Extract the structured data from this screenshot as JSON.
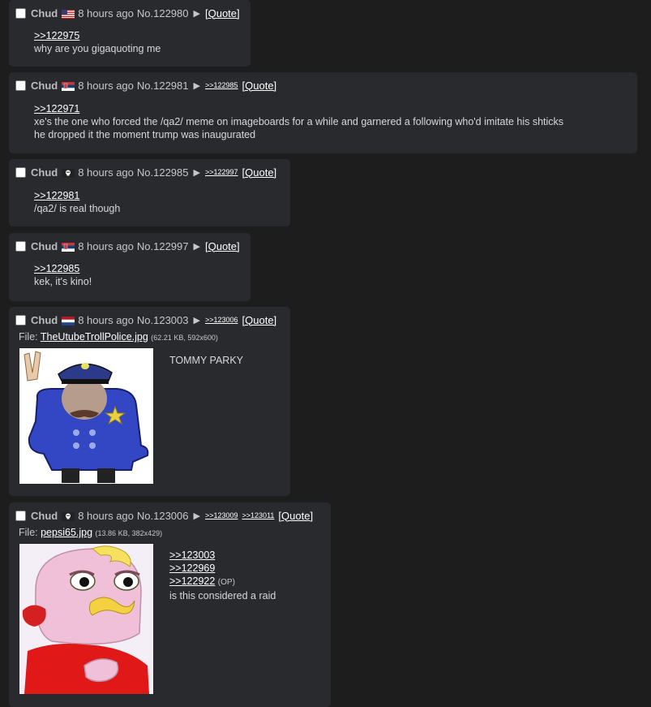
{
  "posts": {
    "p1": {
      "name": "Chud",
      "time": "8 hours ago",
      "no": "No.122980",
      "quote": "[Quote]",
      "lines": {
        "q1": ">>122975",
        "t1": "why are you gigaquoting me"
      }
    },
    "p2": {
      "name": "Chud",
      "time": "8 hours ago",
      "no": "No.122981",
      "backlinks": {
        "b1": ">>122985"
      },
      "quote": "[Quote]",
      "lines": {
        "q1": ">>122971",
        "t1": "xe's the one who forced the /qa2/ meme on imageboards for a while and garnered a following who'd imitate his shticks",
        "t2": "he dropped it the moment trump was inaugurated"
      }
    },
    "p3": {
      "name": "Chud",
      "time": "8 hours ago",
      "no": "No.122985",
      "backlinks": {
        "b1": ">>122997"
      },
      "quote": "[Quote]",
      "lines": {
        "q1": ">>122981",
        "t1": "/qa2/ is real though"
      }
    },
    "p4": {
      "name": "Chud",
      "time": "8 hours ago",
      "no": "No.122997",
      "quote": "[Quote]",
      "lines": {
        "q1": ">>122985",
        "t1": "kek, it's kino!"
      }
    },
    "p5": {
      "name": "Chud",
      "time": "8 hours ago",
      "no": "No.123003",
      "backlinks": {
        "b1": ">>123006"
      },
      "quote": "[Quote]",
      "file": {
        "label": "File:",
        "name": "TheUtubeTrollPolice.jpg",
        "info": "(62.21 KB, 592x600)"
      },
      "lines": {
        "t1": "TOMMY PARKY"
      }
    },
    "p6": {
      "name": "Chud",
      "time": "8 hours ago",
      "no": "No.123006",
      "backlinks": {
        "b1": ">>123009",
        "b2": ">>123011"
      },
      "quote": "[Quote]",
      "file": {
        "label": "File:",
        "name": "pepsi65.jpg",
        "info": "(13.86 KB, 382x429)"
      },
      "lines": {
        "q1": ">>123003",
        "q2": ">>122969",
        "q3": ">>122922",
        "op": "(OP)",
        "t1": "is this considered a raid"
      }
    }
  },
  "flags": {
    "p1": "us-flag",
    "p2": "serbia-flag",
    "p3": "pirate-flag",
    "p4": "serbia-flag",
    "p5": "netherlands-flag",
    "p6": "pirate-flag"
  },
  "colors": {
    "background": "#1d1d1e",
    "post_bg": "#282a2e",
    "link": "#ffffff",
    "text": "#c5c8c6"
  }
}
